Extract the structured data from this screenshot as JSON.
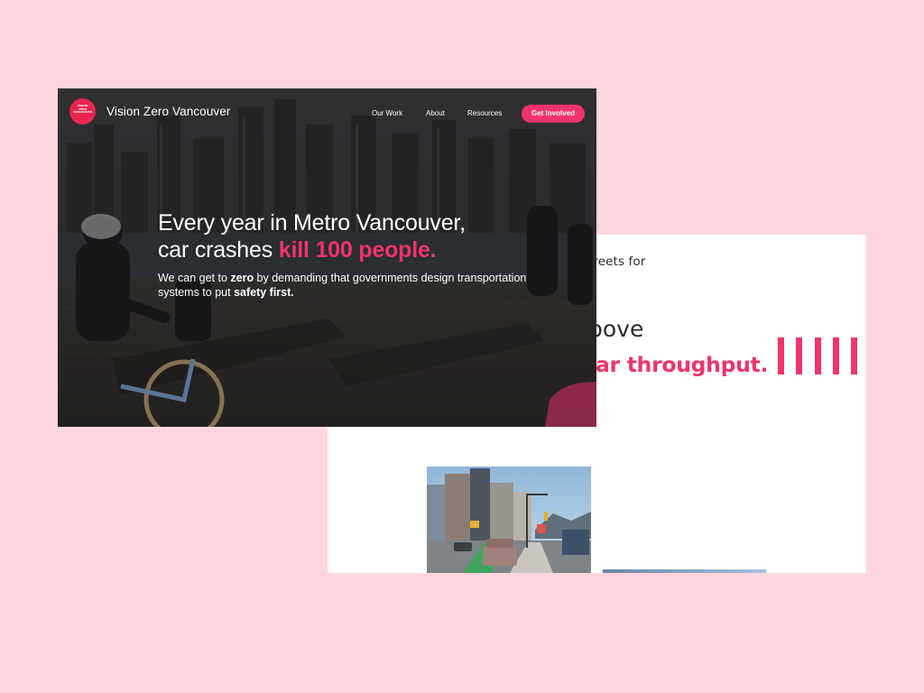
{
  "back_page": {
    "fragment_intro": "treets for",
    "fragment_heading": "bove",
    "fragment_accent": "ar throughput.",
    "tally_marks": 5,
    "accent_color": "#f0336b"
  },
  "hero": {
    "brand": {
      "logo_text": [
        "VISION",
        "ZERO",
        "VANCOUVER"
      ],
      "name": "Vision Zero Vancouver"
    },
    "nav": {
      "links": [
        "Our Work",
        "About",
        "Resources"
      ],
      "cta": "Get Involved"
    },
    "headline": {
      "line1": "Every year in Metro Vancouver,",
      "line2_prefix": "car crashes ",
      "line2_accent": "kill 100 people."
    },
    "subhead": {
      "part1": "We can get to ",
      "bold1": "zero",
      "part2": " by demanding that governments design transportation systems to put ",
      "bold2": "safety first."
    },
    "accent_color": "#f0336b"
  }
}
